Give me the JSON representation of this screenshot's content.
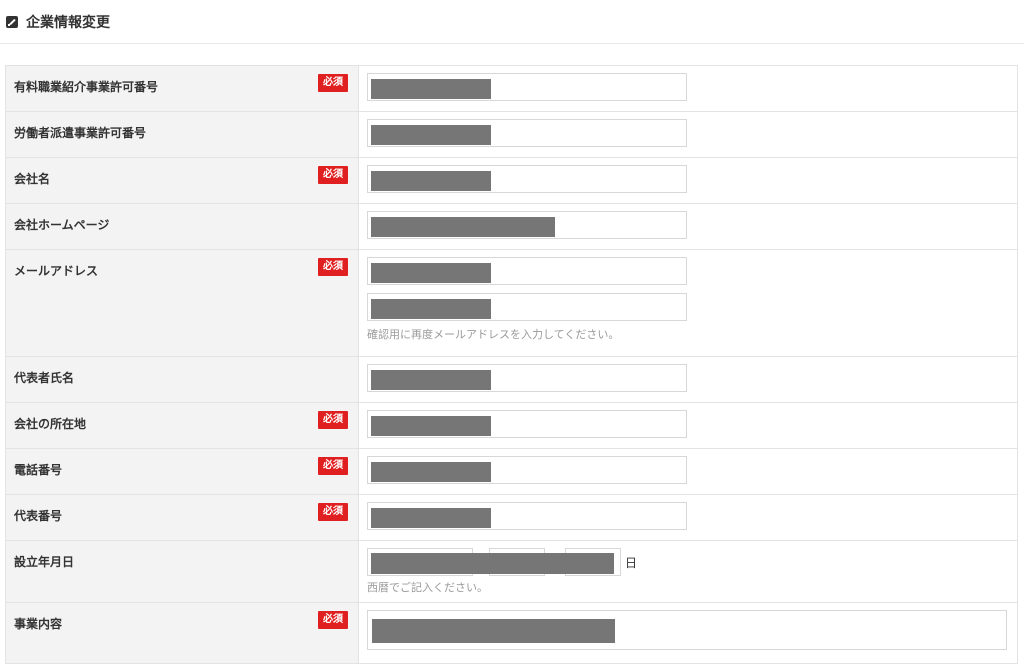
{
  "header": {
    "title": "企業情報変更"
  },
  "required_label": "必須",
  "rows": [
    {
      "label": "有料職業紹介事業許可番号",
      "required": true
    },
    {
      "label": "労働者派遣事業許可番号",
      "required": false
    },
    {
      "label": "会社名",
      "required": true
    },
    {
      "label": "会社ホームページ",
      "required": false
    },
    {
      "label": "メールアドレス",
      "required": true,
      "help": "確認用に再度メールアドレスを入力してください。"
    },
    {
      "label": "代表者氏名",
      "required": false
    },
    {
      "label": "会社の所在地",
      "required": true
    },
    {
      "label": "電話番号",
      "required": true
    },
    {
      "label": "代表番号",
      "required": true
    },
    {
      "label": "設立年月日",
      "required": false,
      "unit_day": "日",
      "help": "西暦でご記入ください。"
    },
    {
      "label": "事業内容",
      "required": true
    }
  ],
  "colors": {
    "required_badge": "#e02020",
    "label_bg": "#f3f3f3",
    "mask": "#767676"
  }
}
